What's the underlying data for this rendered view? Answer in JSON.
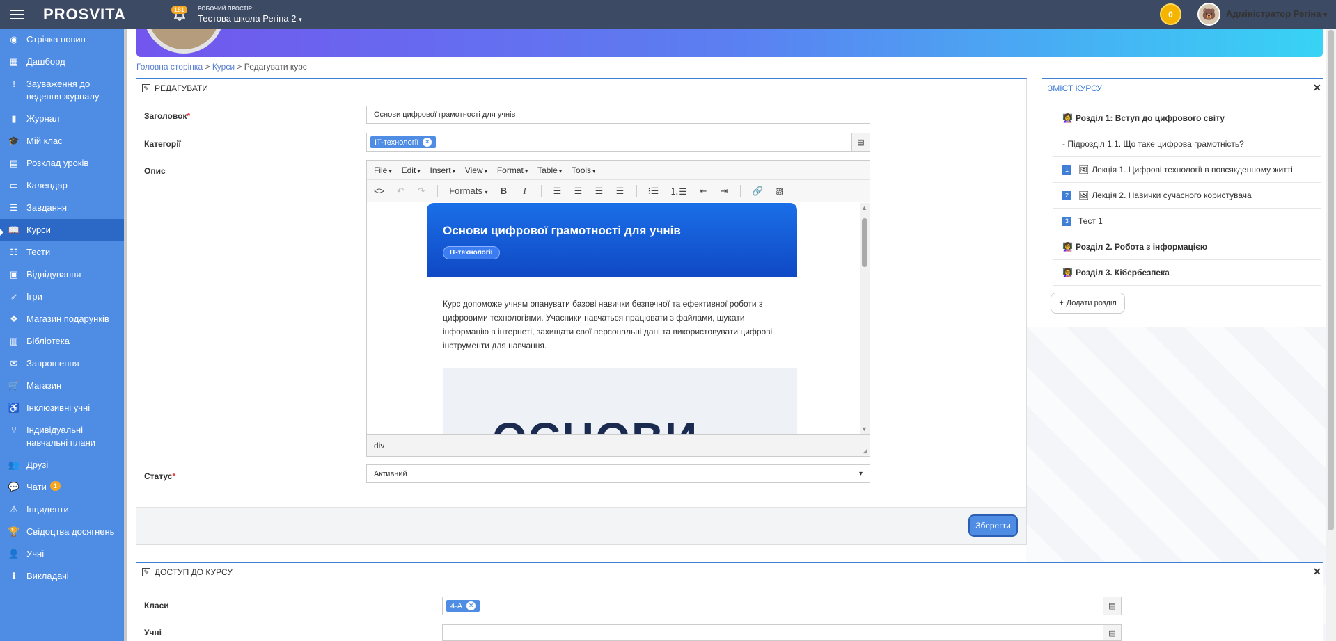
{
  "topbar": {
    "logo": "PROSVITA",
    "notifications_count": "181",
    "workspace_label": "РОБОЧИЙ ПРОСТІР:",
    "workspace_name": "Тестова школа Регіна 2",
    "coins": "0",
    "user_name": "Адміністратор Регіна"
  },
  "sidebar": {
    "items": [
      {
        "label": "Стрічка новин",
        "icon": "rss-icon"
      },
      {
        "label": "Дашборд",
        "icon": "dashboard-icon"
      },
      {
        "label": "Зауваження до ведення журналу",
        "icon": "exclamation-icon"
      },
      {
        "label": "Журнал",
        "icon": "bookmark-icon"
      },
      {
        "label": "Мій клас",
        "icon": "graduation-cap-icon"
      },
      {
        "label": "Розклад уроків",
        "icon": "calendar-grid-icon"
      },
      {
        "label": "Календар",
        "icon": "calendar-icon"
      },
      {
        "label": "Завдання",
        "icon": "tasks-icon"
      },
      {
        "label": "Курси",
        "icon": "book-open-icon"
      },
      {
        "label": "Тести",
        "icon": "list-icon"
      },
      {
        "label": "Відвідування",
        "icon": "attendance-icon"
      },
      {
        "label": "Ігри",
        "icon": "rocket-icon"
      },
      {
        "label": "Магазин подарунків",
        "icon": "gift-icon"
      },
      {
        "label": "Бібліотека",
        "icon": "library-icon"
      },
      {
        "label": "Запрошення",
        "icon": "envelope-icon"
      },
      {
        "label": "Магазин",
        "icon": "cart-icon"
      },
      {
        "label": "Інклюзивні учні",
        "icon": "inclusive-icon"
      },
      {
        "label": "Індивідуальні навчальні плани",
        "icon": "branch-icon"
      },
      {
        "label": "Друзі",
        "icon": "friends-icon"
      },
      {
        "label": "Чати",
        "icon": "chat-icon",
        "badge": "1"
      },
      {
        "label": "Інциденти",
        "icon": "warning-icon"
      },
      {
        "label": "Свідоцтва досягнень",
        "icon": "trophy-icon"
      },
      {
        "label": "Учні",
        "icon": "users-icon"
      },
      {
        "label": "Викладачі",
        "icon": "teacher-icon"
      }
    ]
  },
  "breadcrumb": {
    "home": "Головна сторінка",
    "courses": "Курси",
    "current": "Редагувати курс"
  },
  "edit_panel": {
    "title": "РЕДАГУВАТИ",
    "title_label": "Заголовок",
    "title_value": "Основи цифрової грамотності для учнів",
    "category_label": "Категорії",
    "category_tag": "IT-технології",
    "description_label": "Опис",
    "status_label": "Статус",
    "status_value": "Активний",
    "save_label": "Зберегти"
  },
  "editor": {
    "menus": [
      "File",
      "Edit",
      "Insert",
      "View",
      "Format",
      "Table",
      "Tools"
    ],
    "formats_label": "Formats",
    "statusbar_path": "div",
    "card_title": "Основи цифрової грамотності для учнів",
    "card_tag": "IT-технології",
    "card_text": "Курс допоможе учням опанувати базові навички безпечної та ефективної роботи з цифровими технологіями. Учасники навчаться працювати з файлами, шукати інформацію в інтернеті, захищати свої персональні дані та використовувати цифрові інструменти для навчання.",
    "image_text": "ОСНОВИ"
  },
  "course_content": {
    "title": "ЗМІСТ КУРСУ",
    "items": [
      {
        "type": "section",
        "label": "Розділ 1: Вступ до цифрового світу"
      },
      {
        "type": "subsection",
        "label": "- Підрозділ 1.1. Що таке цифрова грамотність?"
      },
      {
        "type": "lecture",
        "num": "1",
        "label": "Лекція 1. Цифрові технології в повсякденному житті"
      },
      {
        "type": "lecture",
        "num": "2",
        "label": "Лекція 2. Навички сучасного користувача"
      },
      {
        "type": "test",
        "num": "3",
        "label": "Тест 1"
      },
      {
        "type": "section",
        "label": "Розділ 2. Робота з інформацією"
      },
      {
        "type": "section",
        "label": "Розділ 3. Кібербезпека"
      }
    ],
    "add_section_label": "Додати розділ"
  },
  "access_panel": {
    "title": "ДОСТУП ДО КУРСУ",
    "classes_label": "Класи",
    "class_tag": "4-А",
    "students_label": "Учні"
  }
}
